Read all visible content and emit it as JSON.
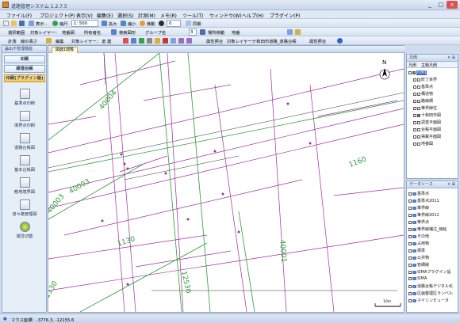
{
  "app": {
    "title": "道路管理システム 1.2.7.5"
  },
  "menu": [
    "ファイル(F)",
    "プロジェクト(P)",
    "表示(V)",
    "編集(E)",
    "選択(S)",
    "計測(M)",
    "メモ(R)",
    "ツール(T)",
    "ウィンドウ(W)",
    "ヘルプ(H)",
    "プラグイン(P)"
  ],
  "toolbar1": {
    "display": "表示 -",
    "zoom_label": "縮尺",
    "scale": "1:  500",
    "zoom_in": "拡大",
    "zoom_out": "縮小",
    "move": "移動",
    "count": "0",
    "sync": "同期"
  },
  "toolbar2": {
    "select_layer": "選択範囲",
    "target_layer": "対象レイヤー：",
    "region_type": "地番図",
    "owner": "所有者名",
    "search_layer": "検索図形",
    "group": "グループ名",
    "index": "3",
    "place_move": "場所移動",
    "lot": "地番"
  },
  "toolbar3": {
    "measure": "計測",
    "line_measure": "線の長さ",
    "edit": "編集",
    "target_layer": "対象レイヤー：",
    "construction": "道 建",
    "attr_match": "属性照合",
    "target_layer2": "対象レイヤー：",
    "layer_name": "十和田市道路_道路台帳",
    "attr_match2": "属性照合"
  },
  "left_panel": {
    "header": "論出不管理機能",
    "buttons": [
      "印刷",
      "緑道台帳",
      "印刷(プラグイン版)"
    ],
    "items": [
      "基準点印刷",
      "境界点印刷",
      "道路台帳図",
      "基本台帳図",
      "敷地境界図",
      "道々路管理図",
      "属性切替"
    ]
  },
  "map": {
    "tab": "図面1閲覧",
    "north": "N",
    "scale_text": "10m",
    "labels": [
      "40004",
      "40003",
      "40003",
      "1130",
      "1160",
      "12530",
      "40001",
      "1130"
    ]
  },
  "legend_panel": {
    "title": "凡例",
    "tabs": [
      "凡例",
      "主題凡例"
    ],
    "items": [
      {
        "label": "凡例1",
        "checked": true
      },
      {
        "label": "町丁目界",
        "checked": false
      },
      {
        "label": "基準点",
        "checked": false
      },
      {
        "label": "構造物",
        "checked": false
      },
      {
        "label": "路線網",
        "checked": false
      },
      {
        "label": "筆界線位",
        "checked": false
      },
      {
        "label": "十和田市図",
        "checked": true
      },
      {
        "label": "調査平面図",
        "checked": false
      },
      {
        "label": "台帳平面図",
        "checked": false
      },
      {
        "label": "掲載平面図",
        "checked": false
      },
      {
        "label": "地番図",
        "checked": false
      }
    ]
  },
  "data_panel": {
    "title": "データソース",
    "items": [
      "基準点",
      "基準点2011",
      "筆界線",
      "筆界線2011",
      "筆界点",
      "筆界線補注_線延",
      "その他",
      "占用物",
      "標準",
      "公共物",
      "管網線",
      "SIMAプラグイン設",
      "SIMA",
      "道路台帳デジタル化",
      "区画整理区ランベル",
      "マイシンビュータ"
    ]
  },
  "status": {
    "coords_label": "マウス座標：-3776.3, -12155.6"
  },
  "colors": {
    "accent": "#3163c5",
    "parcel_line": "#9b2fa0",
    "road_line": "#2e9b3a"
  }
}
